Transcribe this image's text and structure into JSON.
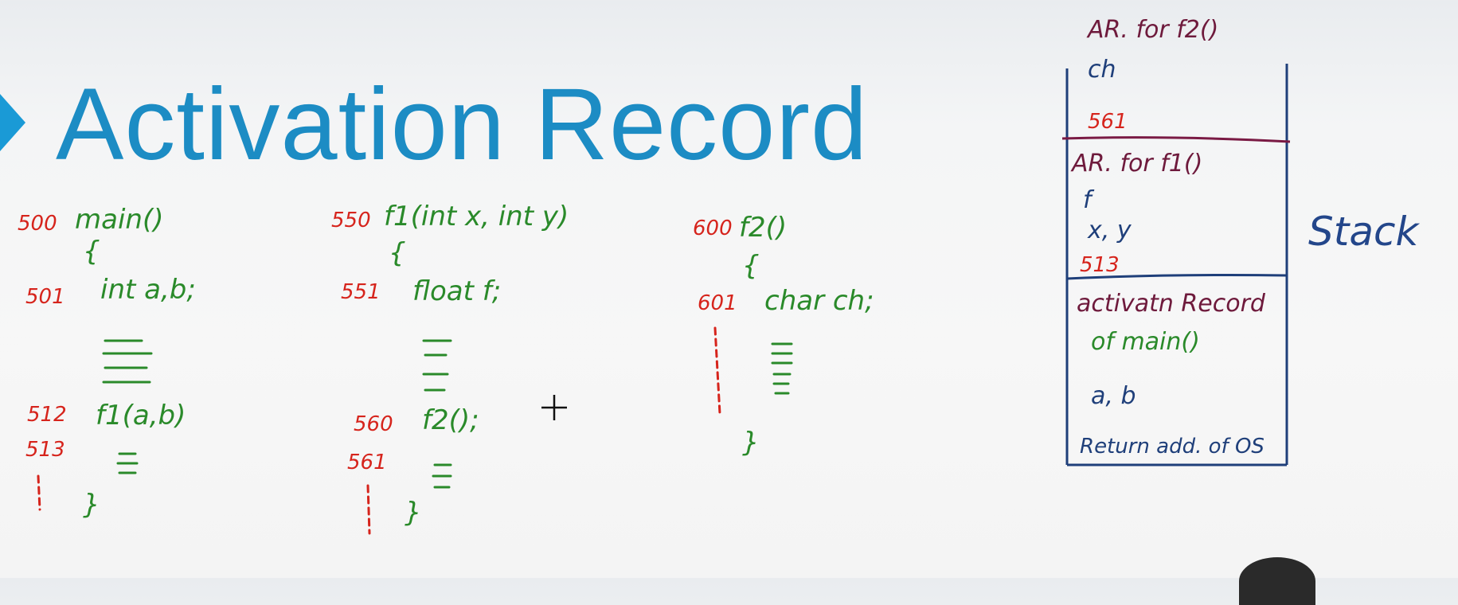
{
  "title": "Activation Record",
  "code": {
    "main": {
      "addr_head": "500",
      "head": "main()",
      "brace_open": "{",
      "addr_decl": "501",
      "decl": "int a,b;",
      "addr_call": "512",
      "call": "f1(a,b)",
      "addr_after": "513",
      "brace_close": "}"
    },
    "f1": {
      "addr_head": "550",
      "head": "f1(int x, int y)",
      "brace_open": "{",
      "addr_decl": "551",
      "decl": "float f;",
      "addr_call": "560",
      "call": "f2();",
      "addr_after": "561",
      "brace_close": "}"
    },
    "f2": {
      "addr_head": "600",
      "head": "f2()",
      "brace_open": "{",
      "addr_decl": "601",
      "decl": "char ch;",
      "brace_close": "}"
    }
  },
  "stack": {
    "f2_record": {
      "title": "AR. for f2()",
      "var": "ch",
      "ret": "561"
    },
    "f1_record": {
      "title": "AR. for f1()",
      "var": "f",
      "params": "x, y",
      "ret": "513"
    },
    "main_record": {
      "title_line1": "activatn Record",
      "title_line2": "of main()",
      "vars": "a, b",
      "ret": "Return add. of OS"
    },
    "label": "Stack"
  },
  "colors": {
    "title": "#1c8cc4",
    "address": "#d6241c",
    "code": "#2a8a2a",
    "stack_line": "#1f3f7a",
    "divider_top": "#7a1a44"
  },
  "icons": [
    "play-arrow-icon",
    "crosshair-cursor-icon"
  ]
}
